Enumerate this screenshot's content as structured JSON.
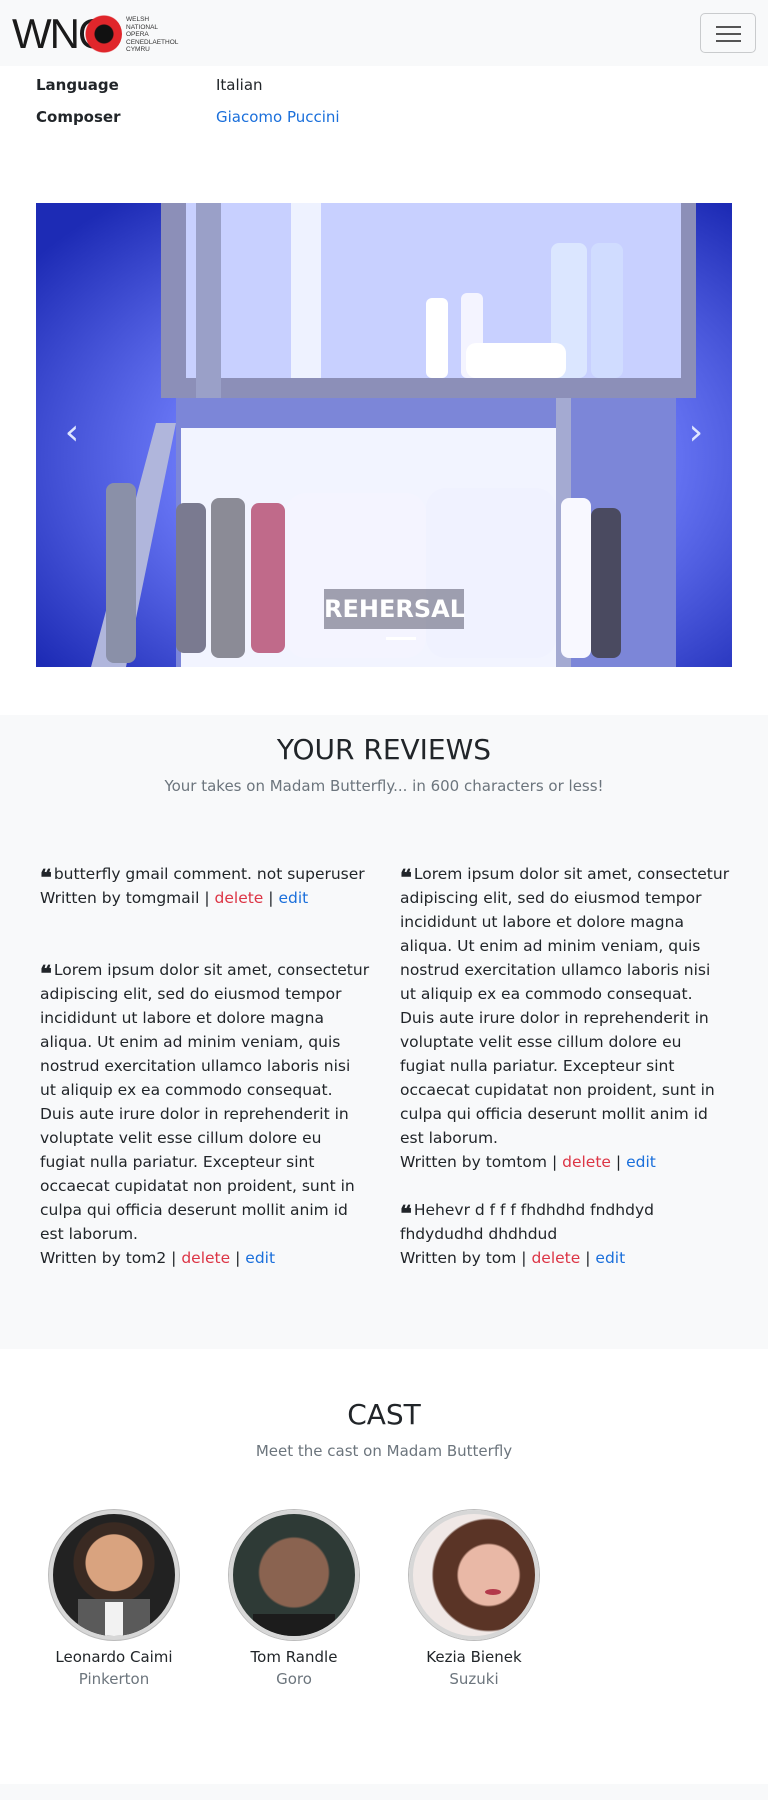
{
  "brand": {
    "logo_wordmark": "WNO",
    "logo_lines": "WELSH\nNATIONAL\nOPERA\nCENEDLAETHOL\nCYMRU"
  },
  "info": {
    "language_label": "Language",
    "language_value": "Italian",
    "composer_label": "Composer",
    "composer_value": "Giacomo Puccini"
  },
  "carousel": {
    "caption": "REHERSAL",
    "prev_icon": "chevron-left-icon",
    "next_icon": "chevron-right-icon"
  },
  "reviews": {
    "title": "YOUR REVIEWS",
    "subtitle": "Your takes on Madam Butterfly... in 600 characters or less!",
    "delete_label": "delete",
    "edit_label": "edit",
    "separator": "|",
    "items": [
      {
        "text": "butterfly gmail comment. not superuser",
        "author_prefix": "Written by tomgmail"
      },
      {
        "text": "Lorem ipsum dolor sit amet, consectetur adipiscing elit, sed do eiusmod tempor incididunt ut labore et dolore magna aliqua. Ut enim ad minim veniam, quis nostrud exercitation ullamco laboris nisi ut aliquip ex ea commodo consequat. Duis aute irure dolor in reprehenderit in voluptate velit esse cillum dolore eu fugiat nulla pariatur. Excepteur sint occaecat cupidatat non proident, sunt in culpa qui officia deserunt mollit anim id est laborum.",
        "author_prefix": "Written by tomtom"
      },
      {
        "text": "Lorem ipsum dolor sit amet, consectetur adipiscing elit, sed do eiusmod tempor incididunt ut labore et dolore magna aliqua. Ut enim ad minim veniam, quis nostrud exercitation ullamco laboris nisi ut aliquip ex ea commodo consequat. Duis aute irure dolor in reprehenderit in voluptate velit esse cillum dolore eu fugiat nulla pariatur. Excepteur sint occaecat cupidatat non proident, sunt in culpa qui officia deserunt mollit anim id est laborum.",
        "author_prefix": "Written by tom2"
      },
      {
        "text": "Hehevr d f f f fhdhdhd fndhdyd fhdydudhd dhdhdud",
        "author_prefix": "Written by tom"
      }
    ]
  },
  "cast": {
    "title": "CAST",
    "subtitle": "Meet the cast on Madam Butterfly",
    "members": [
      {
        "name": "Leonardo Caimi",
        "role": "Pinkerton"
      },
      {
        "name": "Tom Randle",
        "role": "Goro"
      },
      {
        "name": "Kezia Bienek",
        "role": "Suzuki"
      }
    ]
  },
  "colors": {
    "accent_link": "#1a6fdb",
    "delete_red": "#dc3545",
    "stage_blue": "#2438c8"
  }
}
